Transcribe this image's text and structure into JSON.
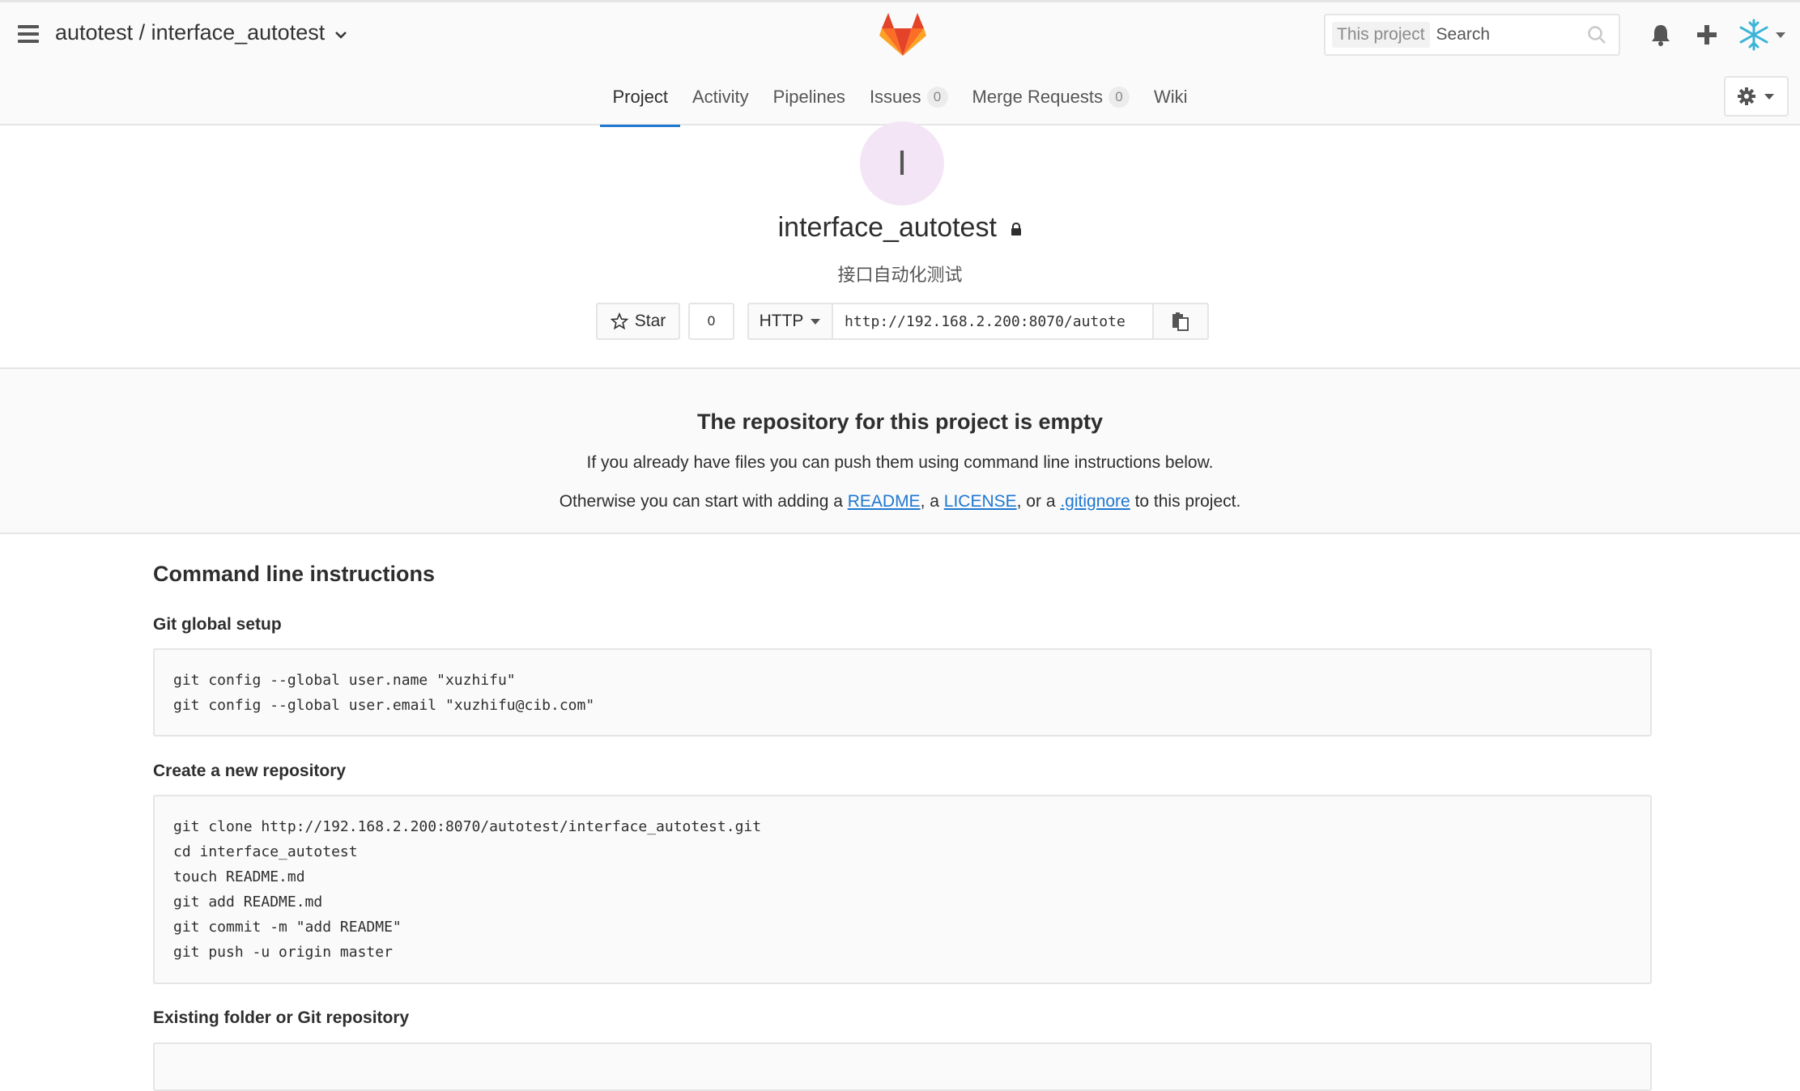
{
  "header": {
    "breadcrumb": "autotest / interface_autotest",
    "search": {
      "scope": "This project",
      "placeholder": "Search"
    },
    "tabs": [
      {
        "label": "Project"
      },
      {
        "label": "Activity"
      },
      {
        "label": "Pipelines"
      },
      {
        "label": "Issues",
        "count": "0"
      },
      {
        "label": "Merge Requests",
        "count": "0"
      },
      {
        "label": "Wiki"
      }
    ]
  },
  "project": {
    "avatar_letter": "I",
    "name": "interface_autotest",
    "description": "接口自动化测试",
    "star_label": "Star",
    "star_count": "0",
    "protocol": "HTTP",
    "clone_url": "http://192.168.2.200:8070/autote"
  },
  "empty": {
    "title": "The repository for this project is empty",
    "line1": "If you already have files you can push them using command line instructions below.",
    "line2_prefix": "Otherwise you can start with adding a ",
    "readme": "README",
    "sep1": ", a ",
    "license": "LICENSE",
    "sep2": ", or a ",
    "gitignore": ".gitignore",
    "line2_suffix": " to this project."
  },
  "instructions": {
    "title": "Command line instructions",
    "global_setup": {
      "title": "Git global setup",
      "code": "git config --global user.name \"xuzhifu\"\ngit config --global user.email \"xuzhifu@cib.com\""
    },
    "new_repo": {
      "title": "Create a new repository",
      "code": "git clone http://192.168.2.200:8070/autotest/interface_autotest.git\ncd interface_autotest\ntouch README.md\ngit add README.md\ngit commit -m \"add README\"\ngit push -u origin master"
    },
    "existing": {
      "title": "Existing folder or Git repository"
    }
  },
  "colors": {
    "accent": "#1f78d1",
    "logo_orange": "#fc6d26",
    "logo_red": "#e24329",
    "logo_light": "#fca326",
    "avatar_bg": "#f3e5f5"
  },
  "icons": [
    "menu-icon",
    "chevron-down-icon",
    "gitlab-logo-icon",
    "search-icon",
    "bell-icon",
    "plus-icon",
    "snowflake-avatar-icon",
    "gear-icon",
    "lock-icon",
    "star-icon",
    "clipboard-icon"
  ]
}
